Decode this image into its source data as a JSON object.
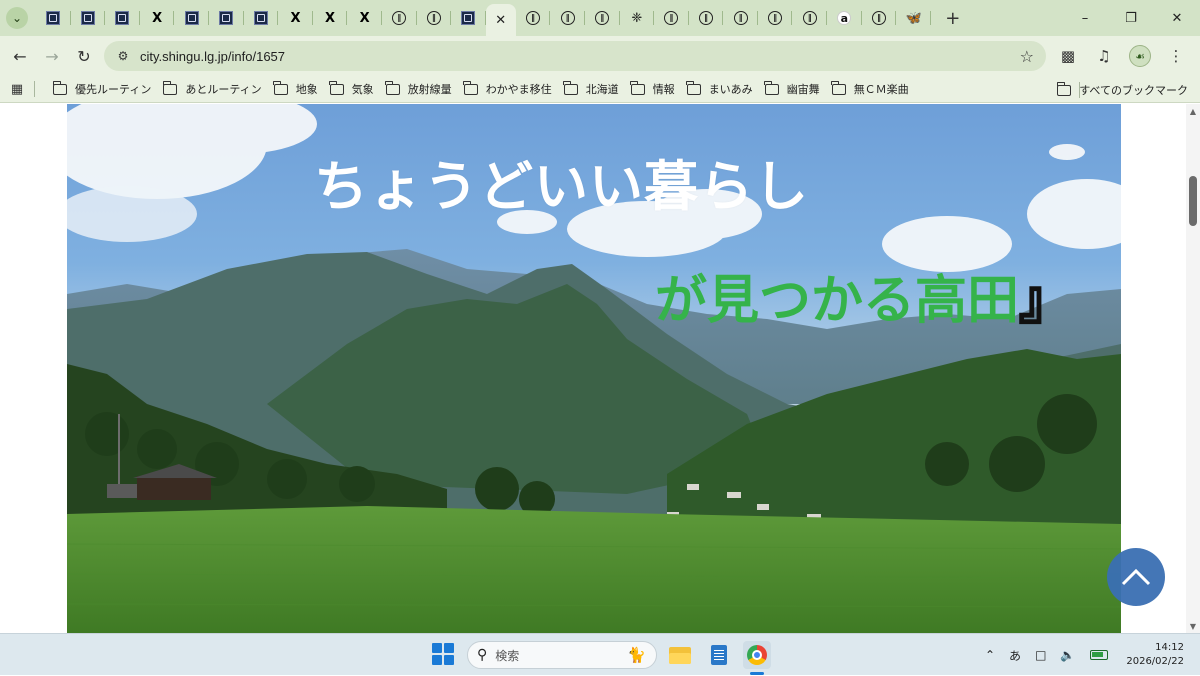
{
  "browser": {
    "tabs": [
      {
        "favicon": "site-logo-icon"
      },
      {
        "favicon": "site-logo-icon"
      },
      {
        "favicon": "site-logo-icon"
      },
      {
        "favicon": "x-logo-icon"
      },
      {
        "favicon": "site-logo-icon"
      },
      {
        "favicon": "site-logo-icon"
      },
      {
        "favicon": "site-logo-icon"
      },
      {
        "favicon": "x-logo-icon"
      },
      {
        "favicon": "x-logo-icon"
      },
      {
        "favicon": "x-logo-icon"
      },
      {
        "favicon": "circle-logo-icon"
      },
      {
        "favicon": "circle-logo-icon"
      },
      {
        "favicon": "site-logo-icon"
      },
      {
        "favicon": "close-icon",
        "active": true
      },
      {
        "favicon": "circle-logo-icon"
      },
      {
        "favicon": "circle-logo-icon"
      },
      {
        "favicon": "circle-logo-icon"
      },
      {
        "favicon": "pinwheel-icon"
      },
      {
        "favicon": "circle-logo-icon"
      },
      {
        "favicon": "circle-logo-icon"
      },
      {
        "favicon": "circle-logo-icon"
      },
      {
        "favicon": "circle-logo-icon"
      },
      {
        "favicon": "circle-logo-icon"
      },
      {
        "favicon": "amazon-icon"
      },
      {
        "favicon": "circle-logo-icon"
      },
      {
        "favicon": "bluesky-icon"
      }
    ],
    "url": "city.shingu.lg.jp/info/1657",
    "bookmarks": [
      {
        "label": "優先ルーティン"
      },
      {
        "label": "あとルーティン"
      },
      {
        "label": "地象"
      },
      {
        "label": "気象"
      },
      {
        "label": "放射線量"
      },
      {
        "label": "わかやま移住"
      },
      {
        "label": "北海道"
      },
      {
        "label": "情報"
      },
      {
        "label": "まいあみ"
      },
      {
        "label": "幽宙舞"
      },
      {
        "label": "無ＣＭ楽曲"
      }
    ],
    "all_bookmarks_label": "すべてのブックマーク",
    "accent_color": "#d3e3c7"
  },
  "page": {
    "headline_line1": "ちょうどいい暮らし",
    "headline_line2": "が見つかる高田",
    "headline_bracket": "』",
    "headline_line2_color": "#35b34a",
    "scroll_top_color": "#3a6fb3"
  },
  "taskbar": {
    "search_placeholder": "検索",
    "ime_label": "あ",
    "time": "14:12",
    "date": "2026/02/22"
  }
}
